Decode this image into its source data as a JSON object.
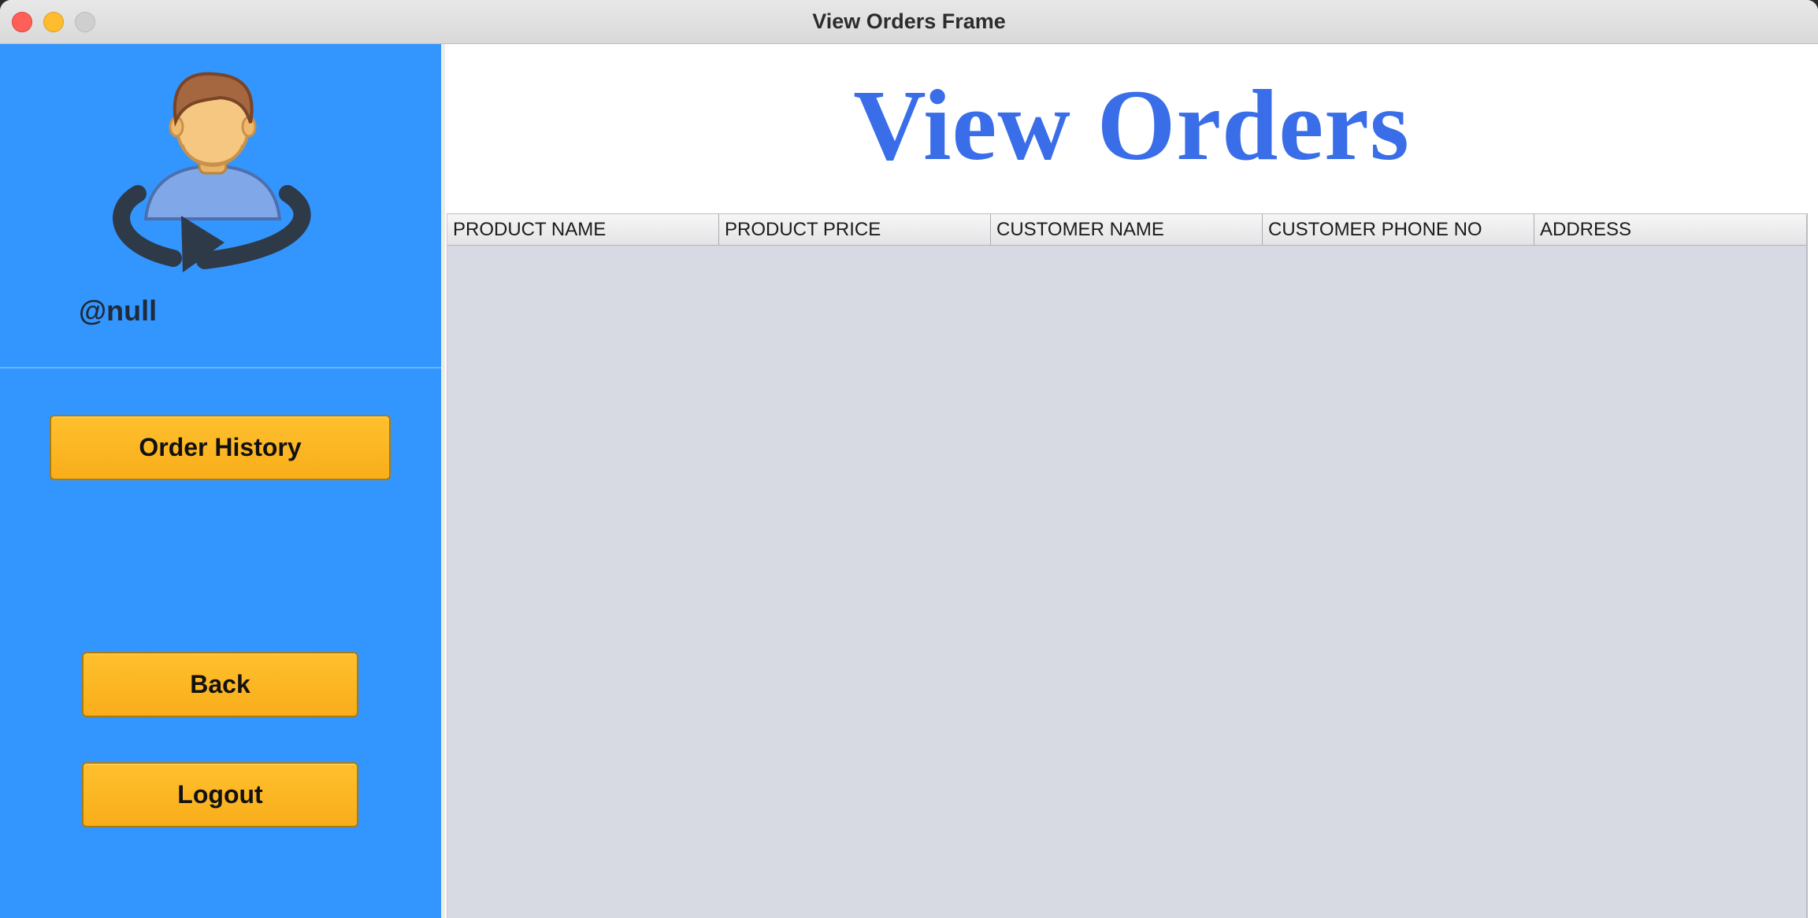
{
  "window": {
    "title": "View Orders Frame"
  },
  "sidebar": {
    "avatar_icon": "user-refresh-icon",
    "username": "@null",
    "buttons": {
      "order_history": "Order History",
      "back": "Back",
      "logout": "Logout"
    }
  },
  "main": {
    "heading": "View Orders",
    "table": {
      "columns": [
        "PRODUCT NAME",
        "PRODUCT PRICE",
        "CUSTOMER NAME",
        "CUSTOMER PHONE NO",
        "ADDRESS"
      ],
      "rows": []
    }
  },
  "colors": {
    "sidebar_bg": "#3396ff",
    "button_bg": "#ffb627",
    "heading_color": "#3a6ee8",
    "table_bg": "#d7dae2"
  }
}
